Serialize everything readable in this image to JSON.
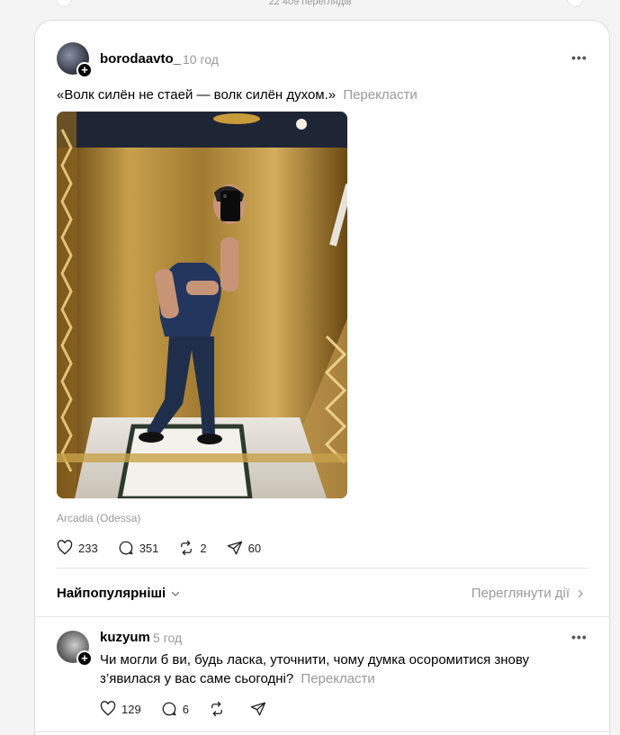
{
  "top": {
    "views": "22 409 переглядів"
  },
  "post": {
    "username": "borodaavto_",
    "time": "10 год",
    "text": "«Волк силён не стаей — волк силён духом.»",
    "translate": "Перекласти",
    "location": "Arcadia (Odessa)",
    "likes": "233",
    "comments": "351",
    "reposts": "2",
    "shares": "60"
  },
  "sort": {
    "label": "Найпопулярніші",
    "view_activity": "Переглянути дії"
  },
  "reply": {
    "username": "kuzyum",
    "time": "5 год",
    "text": "Чи могли б ви, будь ласка, уточнити, чому думка осоромитися знову з’явилася у вас саме сьогодні?",
    "translate": "Перекласти",
    "likes": "129",
    "comments": "6"
  },
  "icons": [
    "plus-icon",
    "more-icon",
    "heart-icon",
    "comment-icon",
    "repost-icon",
    "share-icon",
    "chevron-down-icon",
    "chevron-right-icon"
  ]
}
